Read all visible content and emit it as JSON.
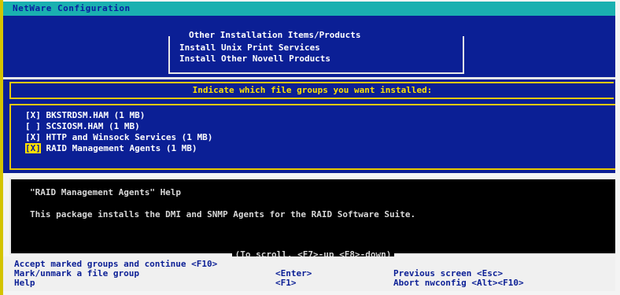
{
  "window": {
    "title": "NetWare Configuration"
  },
  "menu": {
    "title": "Other Installation Items/Products",
    "items": [
      "Install Unix Print Services",
      "Install Other Novell Products"
    ]
  },
  "prompt": "Indicate which file groups you want installed:",
  "file_groups": [
    {
      "mark": "[X]",
      "label": "BKSTRDSM.HAM (1 MB)"
    },
    {
      "mark": "[ ]",
      "label": "SCSIOSM.HAM (1 MB)"
    },
    {
      "mark": "[X]",
      "label": "HTTP and Winsock Services (1 MB)"
    },
    {
      "mark": "[X]",
      "label": "RAID Management Agents (1 MB)"
    }
  ],
  "help": {
    "title": "\"RAID Management Agents\" Help",
    "body": "This package installs the DMI and SNMP Agents for the RAID Software Suite.",
    "scroll_hint": "(To scroll, <F7>-up <F8>-down)"
  },
  "keys": {
    "accept": {
      "label": "Accept marked groups and continue",
      "key": "<F10>"
    },
    "mark": {
      "label": "Mark/unmark a file group",
      "key": "<Enter>"
    },
    "help": {
      "label": "Help",
      "key": "<F1>"
    },
    "previous": {
      "label": "Previous screen",
      "key": "<Esc>"
    },
    "abort": {
      "label": "Abort nwconfig",
      "key": "<Alt><F10>"
    }
  }
}
